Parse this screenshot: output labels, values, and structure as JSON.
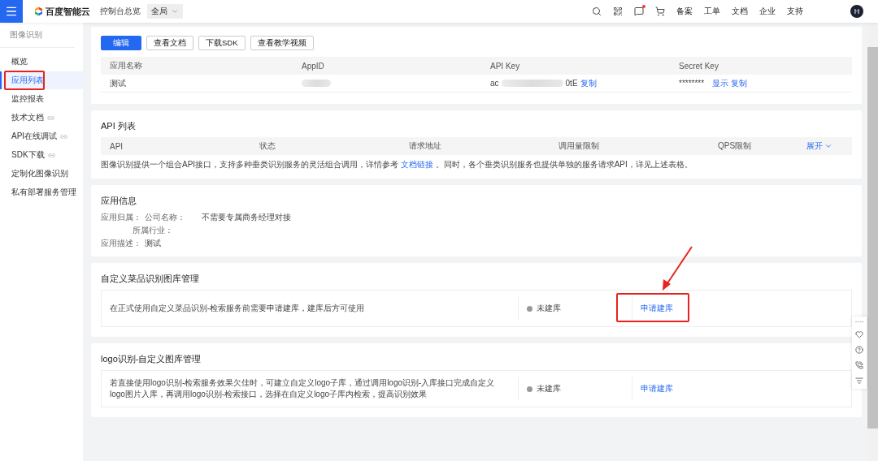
{
  "topbar": {
    "brand": "百度智能云",
    "overview": "控制台总览",
    "region": {
      "value": "全局"
    },
    "links": [
      "备案",
      "工单",
      "文档",
      "企业",
      "支持"
    ],
    "avatar": "H"
  },
  "sidebar": {
    "heading": "图像识别",
    "items": [
      {
        "label": "概览",
        "selected": false,
        "external": false,
        "highlighted": false
      },
      {
        "label": "应用列表",
        "selected": true,
        "external": false,
        "highlighted": true
      },
      {
        "label": "监控报表",
        "selected": false,
        "external": false,
        "highlighted": false
      },
      {
        "label": "技术文档",
        "selected": false,
        "external": true,
        "highlighted": false
      },
      {
        "label": "API在线调试",
        "selected": false,
        "external": true,
        "highlighted": false
      },
      {
        "label": "SDK下载",
        "selected": false,
        "external": true,
        "highlighted": false
      },
      {
        "label": "定制化图像识别",
        "selected": false,
        "external": false,
        "highlighted": false
      },
      {
        "label": "私有部署服务管理",
        "selected": false,
        "external": false,
        "highlighted": false
      }
    ]
  },
  "app": {
    "buttons": [
      {
        "label": "编辑",
        "primary": true
      },
      {
        "label": "查看文档",
        "primary": false
      },
      {
        "label": "下载SDK",
        "primary": false
      },
      {
        "label": "查看教学视频",
        "primary": false
      }
    ],
    "columns": [
      "应用名称",
      "AppID",
      "API Key",
      "Secret Key"
    ],
    "row": {
      "name": "测试",
      "api_key_start": "ac",
      "api_key_end": "0tE",
      "api_key_action": "复制",
      "secret": "********",
      "secret_actions": [
        "显示",
        "复制"
      ]
    }
  },
  "api_list": {
    "title": "API 列表",
    "columns": [
      "API",
      "状态",
      "请求地址",
      "调用量限制",
      "QPS限制"
    ],
    "expand": "展开",
    "note_before": "图像识别提供一个组合API接口，支持多种垂类识别服务的灵活组合调用，详情参考",
    "note_link": "文档链接",
    "note_after": "。同时，各个垂类识别服务也提供单独的服务请求API，详见上述表格。"
  },
  "app_info": {
    "title": "应用信息",
    "fields": [
      {
        "label": "应用归属：",
        "sublabel": "公司名称：",
        "value": "不需要专属商务经理对接"
      },
      {
        "sublabel": "所属行业："
      },
      {
        "label": "应用描述：",
        "value": "测试"
      }
    ]
  },
  "libraries": [
    {
      "title": "自定义菜品识别图库管理",
      "description": "在正式使用自定义菜品识别-检索服务前需要申请建库，建库后方可使用",
      "status": "未建库",
      "action": "申请建库",
      "highlighted": true
    },
    {
      "title": "logo识别-自定义图库管理",
      "description": "若直接使用logo识别-检索服务效果欠佳时，可建立自定义logo子库，通过调用logo识别-入库接口完成自定义logo图片入库，再调用logo识别-检索接口，选择在自定义logo子库内检索，提高识别效果",
      "status": "未建库",
      "action": "申请建库",
      "highlighted": false
    }
  ]
}
